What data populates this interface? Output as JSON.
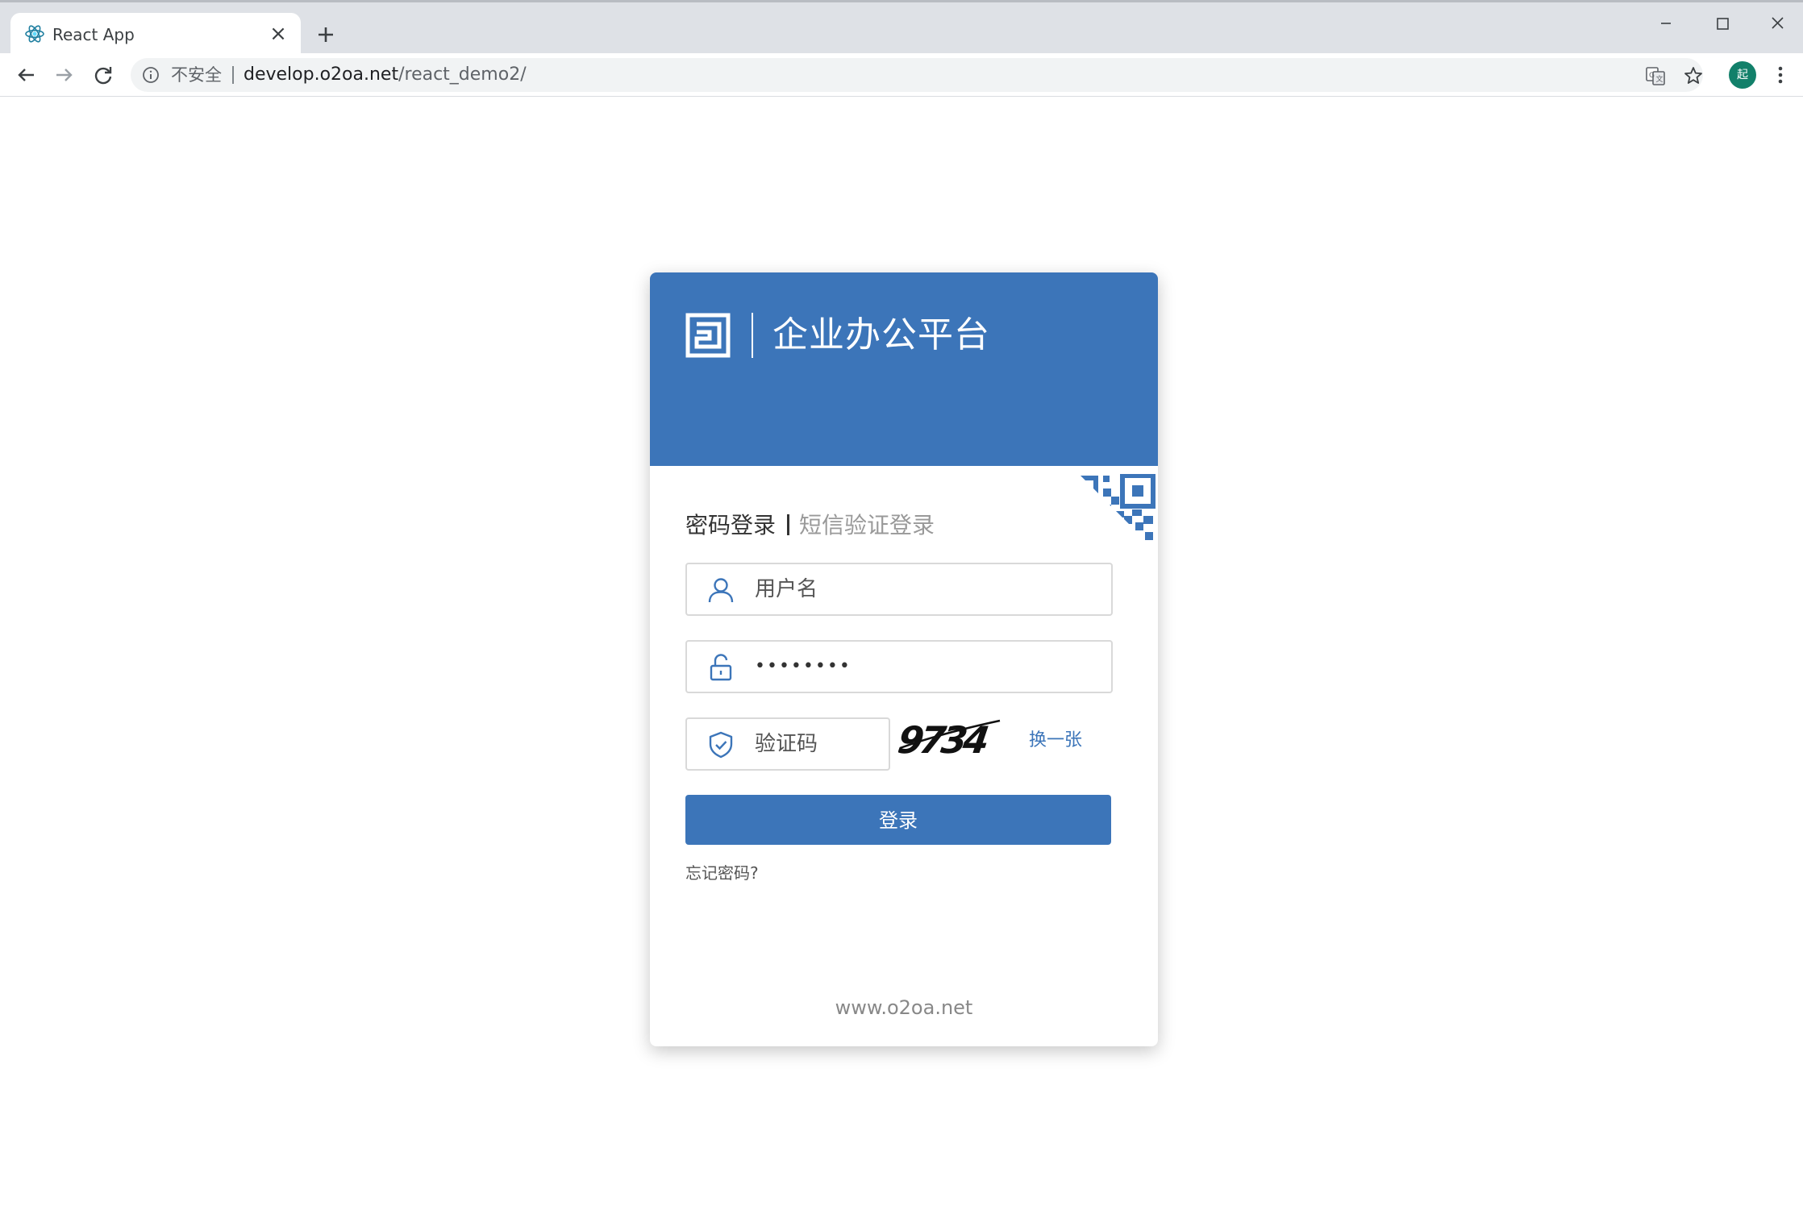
{
  "browser": {
    "tab_title": "React App",
    "tab_close": "×",
    "security_label": "不安全",
    "url_host": "develop.o2oa.net",
    "url_path": "/react_demo2/",
    "profile_initial": "起"
  },
  "login": {
    "platform_title": "企业办公平台",
    "tab_password": "密码登录",
    "tab_sms": "短信验证登录",
    "username_placeholder": "用户名",
    "password_value": "••••••••",
    "captcha_placeholder": "验证码",
    "captcha_text": "9734",
    "refresh_label": "换一张",
    "submit_label": "登录",
    "forgot_label": "忘记密码?",
    "site": "www.o2oa.net"
  },
  "colors": {
    "brand": "#3c75b9",
    "avatar": "#12806a",
    "tabstrip": "#dee1e6"
  },
  "icons": [
    "react-icon",
    "close-icon",
    "plus-icon",
    "minimize-icon",
    "maximize-icon",
    "window-close-icon",
    "back-arrow-icon",
    "forward-arrow-icon",
    "reload-icon",
    "info-icon",
    "translate-icon",
    "star-icon",
    "more-vert-icon",
    "logo-icon",
    "qr-code-icon",
    "user-icon",
    "lock-icon",
    "shield-check-icon"
  ]
}
